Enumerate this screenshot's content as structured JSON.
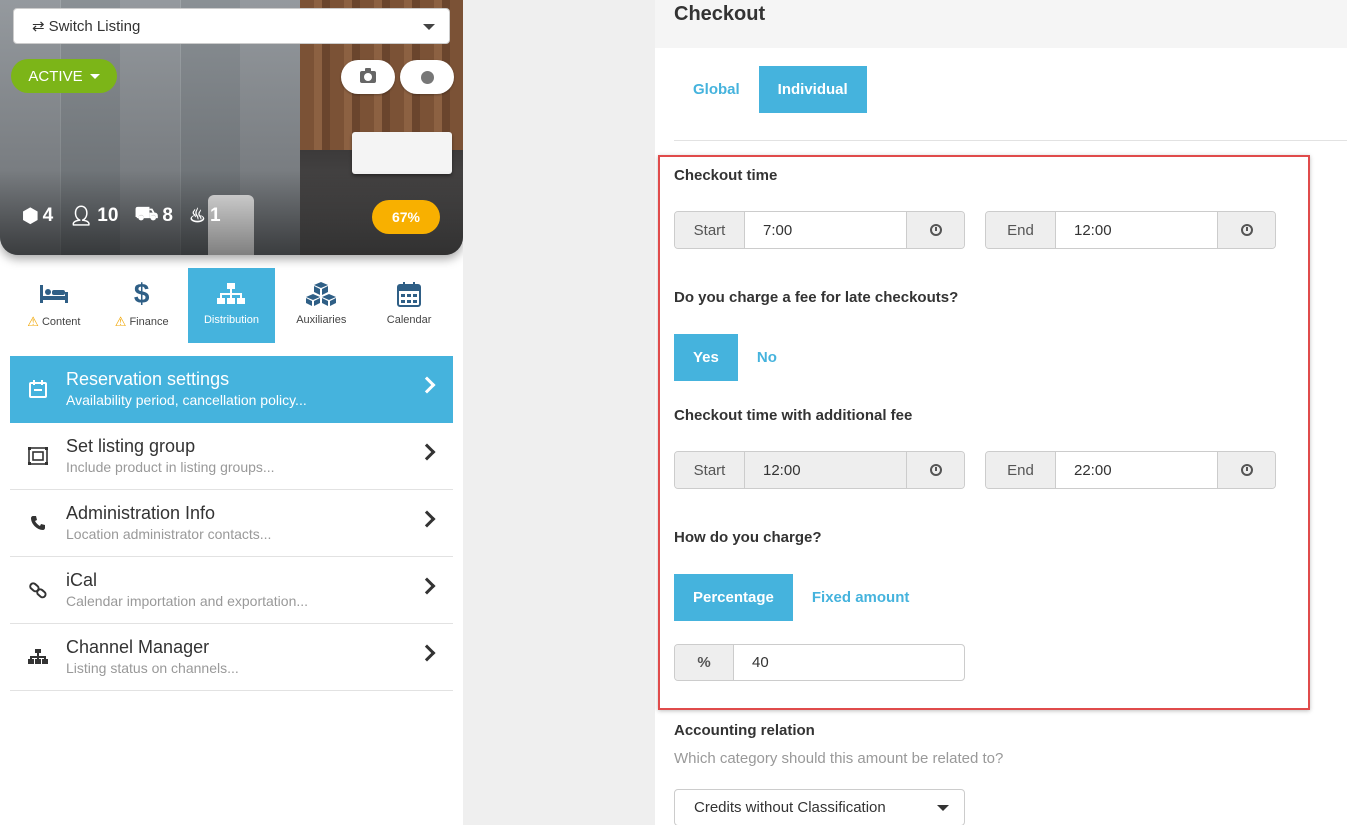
{
  "listing": {
    "switch_label": "Switch Listing",
    "status_label": "ACTIVE",
    "stats": {
      "units": "4",
      "guests": "10",
      "beds": "8",
      "baths": "1"
    },
    "completion": "67%"
  },
  "nav_tabs": [
    {
      "label": "Content",
      "icon": "bed-icon",
      "warning": true,
      "active": false
    },
    {
      "label": "Finance",
      "icon": "dollar-icon",
      "warning": true,
      "active": false
    },
    {
      "label": "Distribution",
      "icon": "sitemap-icon",
      "warning": false,
      "active": true
    },
    {
      "label": "Auxiliaries",
      "icon": "cubes-icon",
      "warning": false,
      "active": false
    },
    {
      "label": "Calendar",
      "icon": "calendar-icon",
      "warning": false,
      "active": false
    }
  ],
  "menu": [
    {
      "title": "Reservation settings",
      "subtitle": "Availability period, cancellation policy...",
      "icon": "calendar-icon",
      "active": true
    },
    {
      "title": "Set listing group",
      "subtitle": "Include product in listing groups...",
      "icon": "group-icon",
      "active": false
    },
    {
      "title": "Administration Info",
      "subtitle": "Location administrator contacts...",
      "icon": "phone-icon",
      "active": false
    },
    {
      "title": "iCal",
      "subtitle": "Calendar importation and exportation...",
      "icon": "link-icon",
      "active": false
    },
    {
      "title": "Channel Manager",
      "subtitle": "Listing status on channels...",
      "icon": "sitemap-icon",
      "active": false
    }
  ],
  "checkout": {
    "title": "Checkout",
    "mode_tabs": {
      "global": "Global",
      "individual": "Individual",
      "selected": "Individual"
    },
    "checkout_time": {
      "label": "Checkout time",
      "start_label": "Start",
      "start_value": "7:00",
      "end_label": "End",
      "end_value": "12:00"
    },
    "late_fee": {
      "question": "Do you charge a fee for late checkouts?",
      "yes": "Yes",
      "no": "No",
      "selected": "Yes"
    },
    "additional_fee_time": {
      "label": "Checkout time with additional fee",
      "start_label": "Start",
      "start_value": "12:00",
      "end_label": "End",
      "end_value": "22:00"
    },
    "charge_method": {
      "question": "How do you charge?",
      "percentage": "Percentage",
      "fixed": "Fixed amount",
      "selected": "Percentage",
      "unit": "%",
      "value": "40"
    },
    "accounting": {
      "label": "Accounting relation",
      "hint": "Which category should this amount be related to?",
      "selected": "Credits without Classification"
    }
  },
  "colors": {
    "accent": "#45b3dd",
    "active_status": "#7cb518",
    "completion": "#f8b000",
    "highlight": "#e04b4b"
  }
}
